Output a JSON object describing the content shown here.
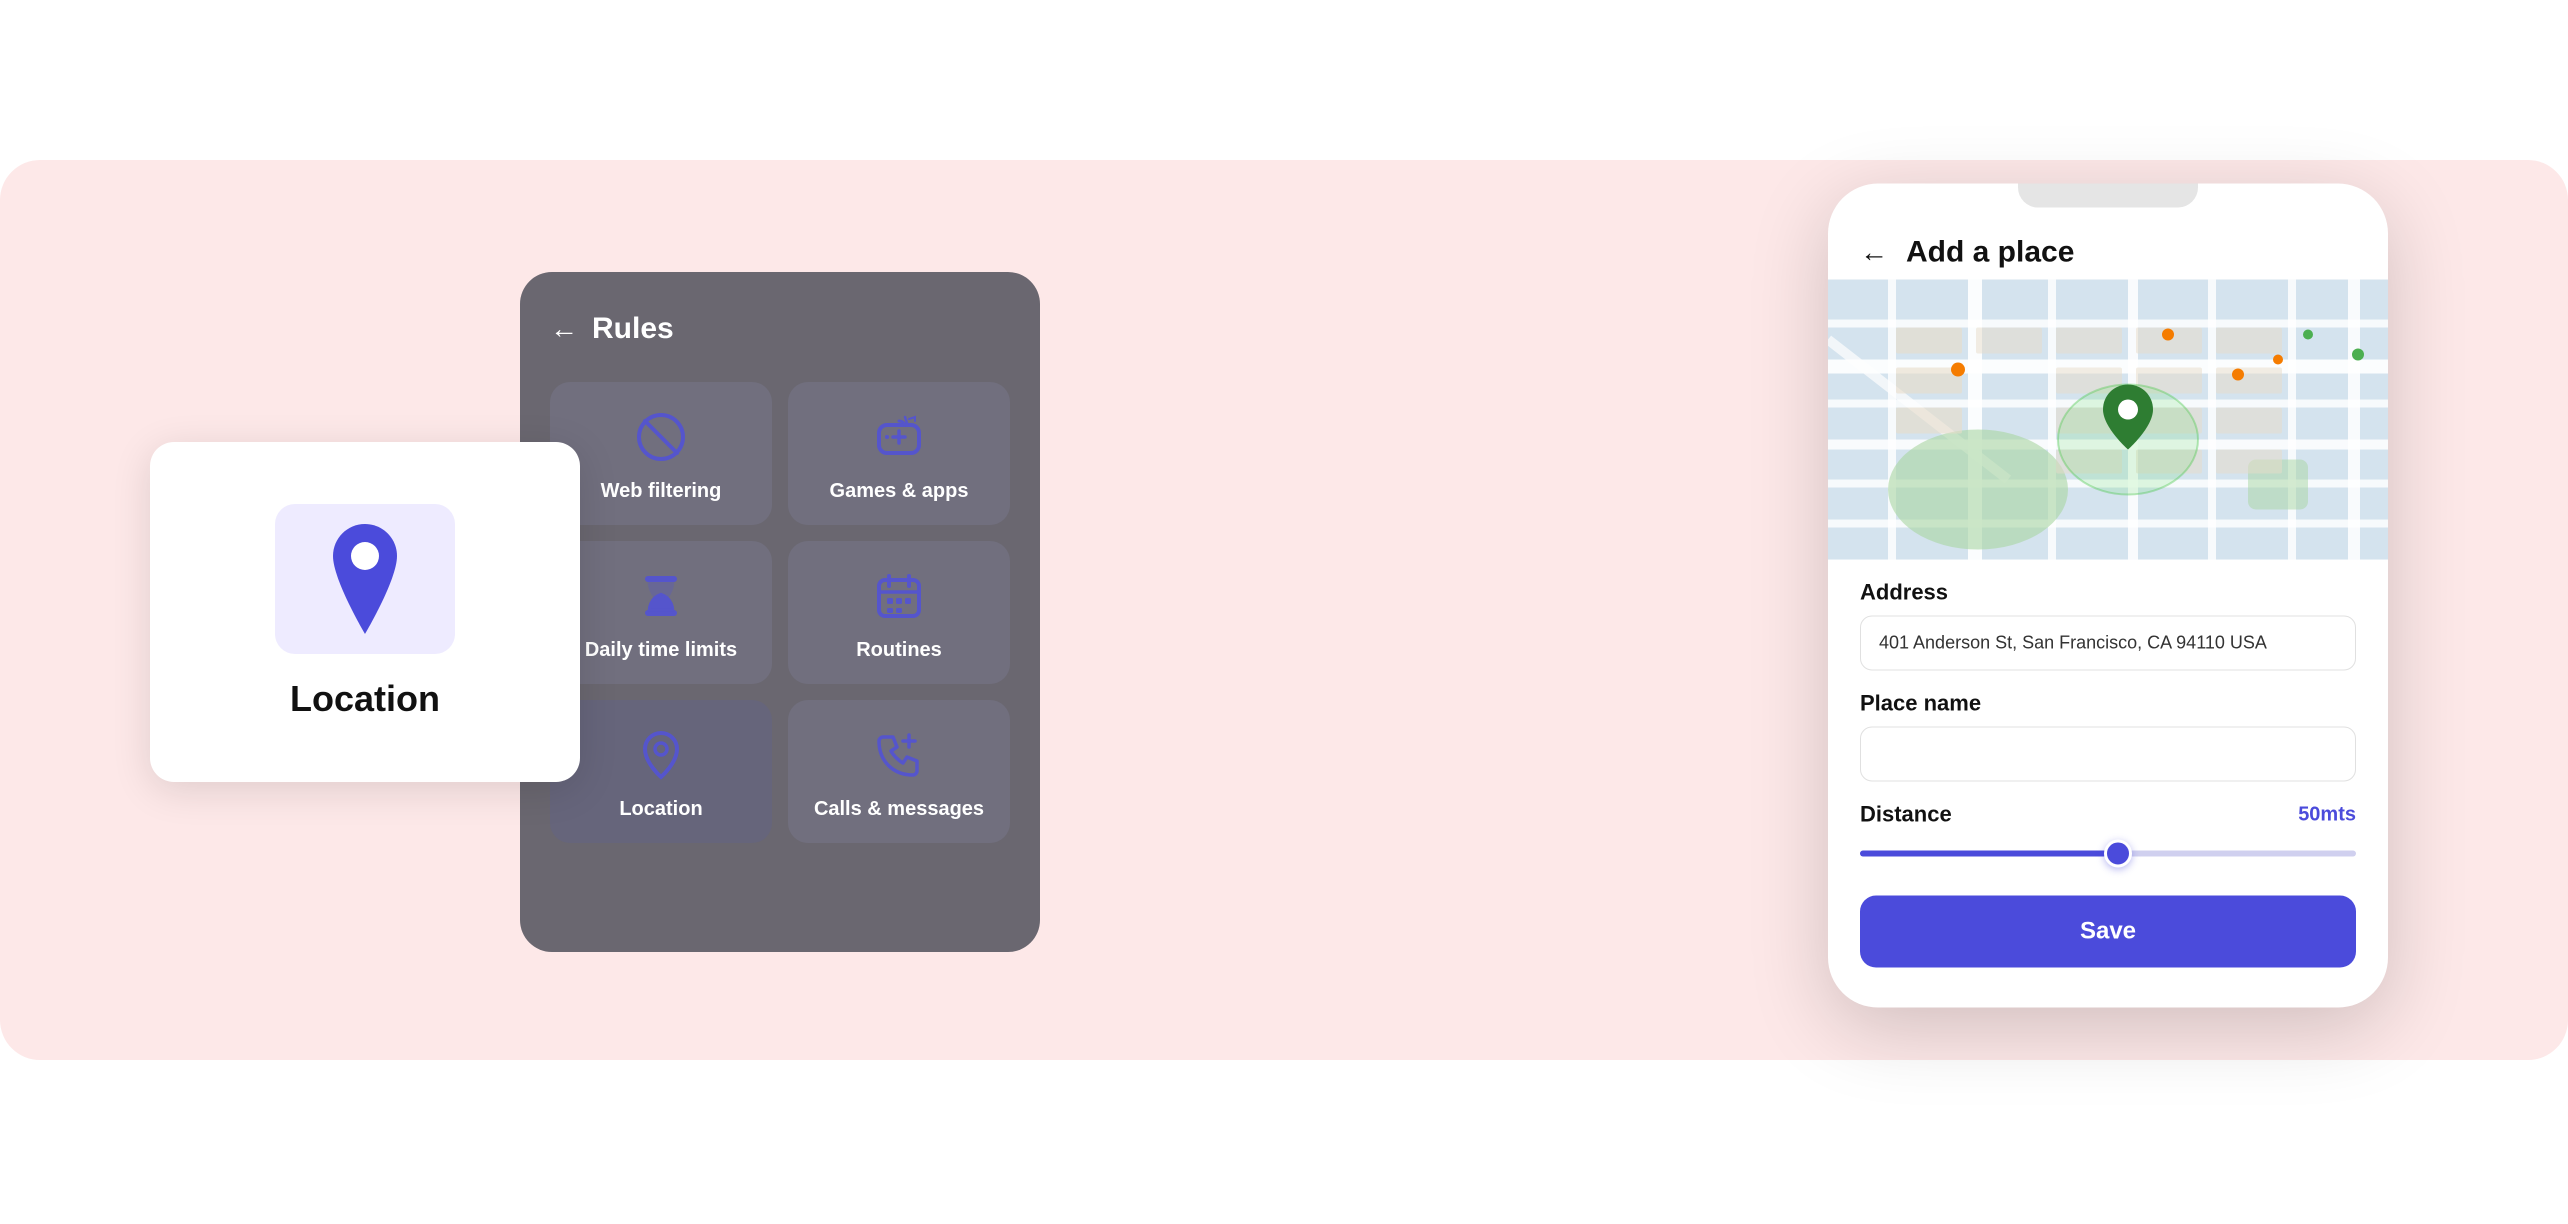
{
  "background": {
    "color": "#fde8e8"
  },
  "location_card": {
    "label": "Location",
    "icon_bg_color": "#eeebff"
  },
  "rules_panel": {
    "back_label": "←",
    "title": "Rules",
    "items": [
      {
        "id": "web-filtering",
        "label": "Web filtering",
        "icon": "ban"
      },
      {
        "id": "games-apps",
        "label": "Games & apps",
        "icon": "games"
      },
      {
        "id": "daily-time-limits",
        "label": "Daily time limits",
        "icon": "hourglass"
      },
      {
        "id": "routines",
        "label": "Routines",
        "icon": "calendar"
      },
      {
        "id": "location",
        "label": "Location",
        "icon": "location"
      },
      {
        "id": "calls-messages",
        "label": "Calls & messages",
        "icon": "phone-plus"
      }
    ]
  },
  "phone": {
    "back_label": "←",
    "title": "Add a place",
    "map": {
      "pin_color": "#2e7d32",
      "circle_color": "rgba(100,200,100,0.25)"
    },
    "address_label": "Address",
    "address_value": "401 Anderson St, San Francisco, CA 94110 USA",
    "place_name_label": "Place name",
    "place_name_placeholder": "",
    "distance_label": "Distance",
    "distance_value": "50mts",
    "slider_percent": 52,
    "save_label": "Save"
  }
}
